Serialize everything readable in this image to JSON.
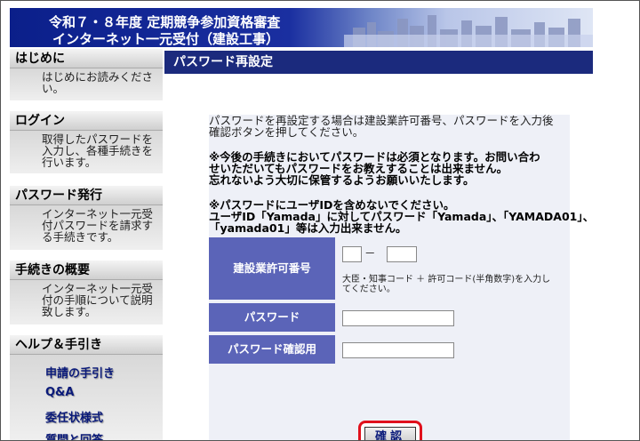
{
  "header": {
    "title_line1": "令和７・８年度 定期競争参加資格審査",
    "title_line2": "インターネット一元受付（建設工事）"
  },
  "sidebar": {
    "sections": [
      {
        "heading": "はじめに",
        "desc": "はじめにお読みください。"
      },
      {
        "heading": "ログイン",
        "desc": "取得したパスワードを入力し、各種手続きを行います。"
      },
      {
        "heading": "パスワード発行",
        "desc": "インターネット一元受付パスワードを請求する手続きです。"
      },
      {
        "heading": "手続きの概要",
        "desc": "インターネット一元受付の手順について説明致します。"
      },
      {
        "heading": "ヘルプ＆手引き"
      }
    ],
    "help_links": [
      "申請の手引き",
      "Q&A",
      "委任状様式",
      "質問と回答"
    ]
  },
  "main": {
    "title": "パスワード再設定",
    "intro_line1": "パスワードを再設定する場合は建設業許可番号、パスワードを入力後",
    "intro_line2": "確認ボタンを押してください。",
    "notice1_line1": "※今後の手続きにおいてパスワードは必須となります。お問い合わ",
    "notice1_line2": "せいただいてもパスワードをお教えすることは出来ません。",
    "notice1_line3": "忘れないよう大切に保管するようお願いいたします。",
    "notice2_line1": "※パスワードにユーザIDを含めないでください。",
    "notice2_line2": "ユーザID「Yamada」に対してパスワード「Yamada」、「YAMADA01」、",
    "notice2_line3": "「yamada01」等は入力出来ません。",
    "form": {
      "license_label": "建設業許可番号",
      "license_hint_line1": "大臣・知事コード ＋ 許可コード(半角数字)を入力し",
      "license_hint_line2": "てください。",
      "license_separator": "－",
      "license_code1_value": "",
      "license_code2_value": "",
      "password_label": "パスワード",
      "password_value": "",
      "password_confirm_label": "パスワード確認用",
      "password_confirm_value": "",
      "confirm_button": "確認"
    }
  }
}
